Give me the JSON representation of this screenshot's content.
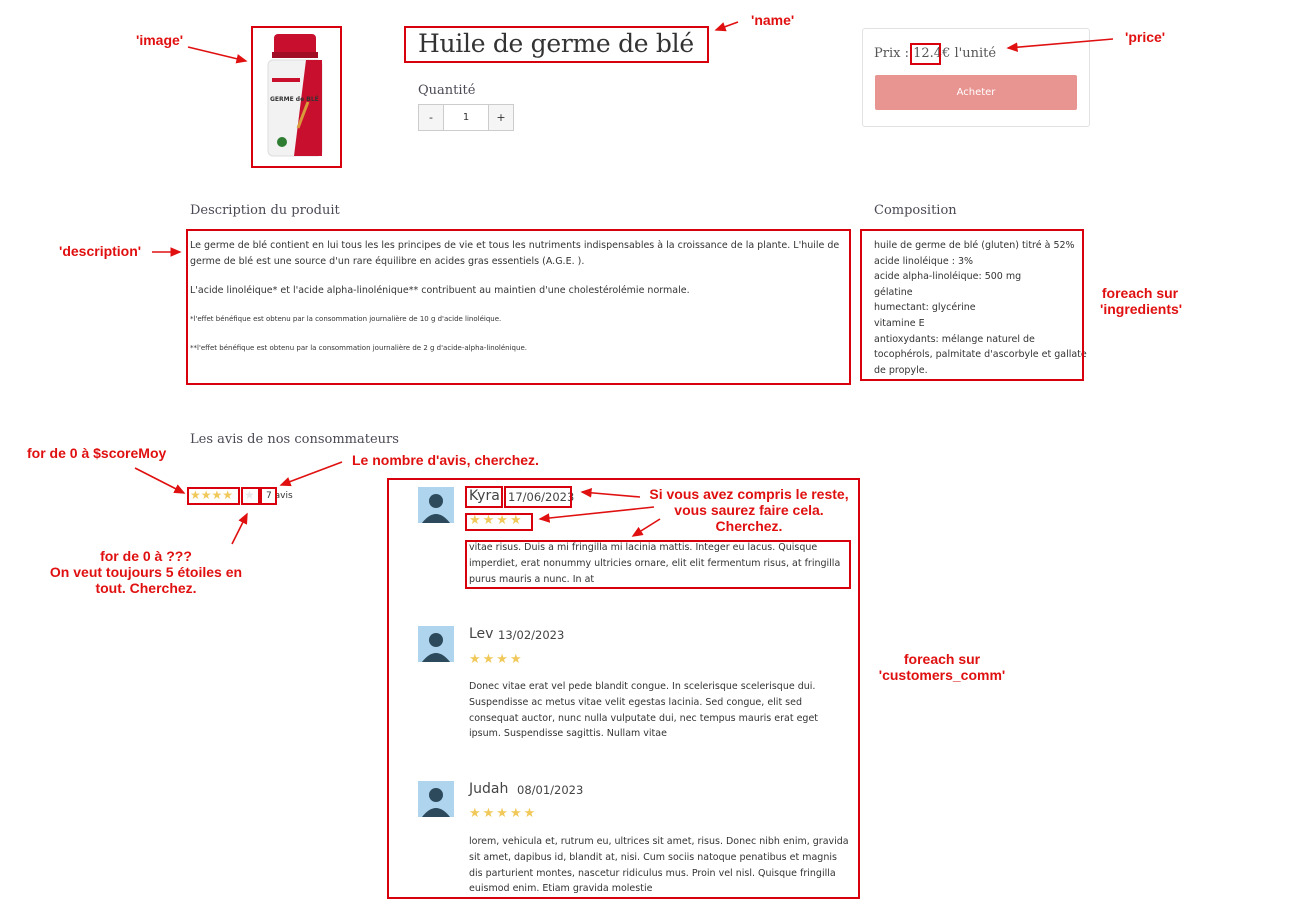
{
  "product": {
    "name": "Huile de germe de blé",
    "quantity_label": "Quantité",
    "quantity_value": "1",
    "minus_label": "-",
    "plus_label": "+",
    "price_prefix": "Prix : ",
    "price_value": "12.4",
    "price_suffix": "€ l'unité",
    "buy_label": "Acheter",
    "image_icon": "supplement-bottle-image",
    "image_label_top": "GERME de BLÉ"
  },
  "description": {
    "title": "Description du produit",
    "p1": "Le germe de blé contient en lui tous les les principes de vie et tous les nutriments indispensables à la croissance de la plante. L'huile de germe de blé est une source d'un rare équilibre en acides gras essentiels (A.G.E. ).",
    "p2": "L'acide linoléique* et l'acide alpha-linolénique** contribuent au maintien d'une cholestérolémie normale.",
    "p3": "*l'effet bénéfique est obtenu par la consommation journalière de 10 g d'acide linoléique.",
    "p4": "**l'effet bénéfique est obtenu par la consommation journalière de 2 g d'acide-alpha-linolénique."
  },
  "composition": {
    "title": "Composition",
    "lines": [
      "huile de germe de blé (gluten) titré à 52%",
      "acide linoléique : 3%",
      "acide alpha-linoléique: 500 mg",
      "gélatine",
      "humectant: glycérine",
      "vitamine E",
      "antioxydants: mélange naturel de",
      "tocophérols, palmitate d'ascorbyle et gallate",
      "de propyle."
    ]
  },
  "reviews": {
    "title": "Les avis de nos consommateurs",
    "avg_stars": "★★★★",
    "empty_star": "★",
    "count": "7",
    "count_suffix": "avis",
    "items": [
      {
        "name": "Kyra",
        "date": "17/06/2023",
        "stars": "★★★★",
        "text": "vitae risus. Duis a mi fringilla mi lacinia mattis. Integer eu lacus. Quisque imperdiet, erat nonummy ultricies ornare, elit elit fermentum risus, at fringilla purus mauris a nunc. In at"
      },
      {
        "name": "Lev",
        "date": "13/02/2023",
        "stars": "★★★★",
        "text": "Donec vitae erat vel pede blandit congue. In scelerisque scelerisque dui. Suspendisse ac metus vitae velit egestas lacinia. Sed congue, elit sed consequat auctor, nunc nulla vulputate dui, nec tempus mauris erat eget ipsum. Suspendisse sagittis. Nullam vitae"
      },
      {
        "name": "Judah",
        "date": "08/01/2023",
        "stars": "★★★★★",
        "text": "lorem, vehicula et, rutrum eu, ultrices sit amet, risus. Donec nibh enim, gravida sit amet, dapibus id, blandit at, nisi. Cum sociis natoque penatibus et magnis dis parturient montes, nascetur ridiculus mus. Proin vel nisl. Quisque fringilla euismod enim. Etiam gravida molestie"
      }
    ]
  },
  "annotations": {
    "image": "'image'",
    "name": "'name'",
    "price": "'price'",
    "description": "'description'",
    "ingredients_1": "foreach sur",
    "ingredients_2": "'ingredients'",
    "score_loop": "for de 0 à $scoreMoy",
    "count_hint": "Le nombre d'avis, cherchez.",
    "empty_loop_1": "for de 0 à ???",
    "empty_loop_2": "On veut toujours 5 étoiles en",
    "empty_loop_3": "tout. Cherchez.",
    "rest_1": "Si vous avez compris le reste,",
    "rest_2": "vous saurez faire cela.",
    "rest_3": "Cherchez.",
    "comments_1": "foreach sur",
    "comments_2": "'customers_comm'"
  },
  "colors": {
    "annotation_red": "#d9000d",
    "buy_button": "#e89490",
    "star_gold": "#f1c95b",
    "avatar_bg": "#aed4ee"
  }
}
